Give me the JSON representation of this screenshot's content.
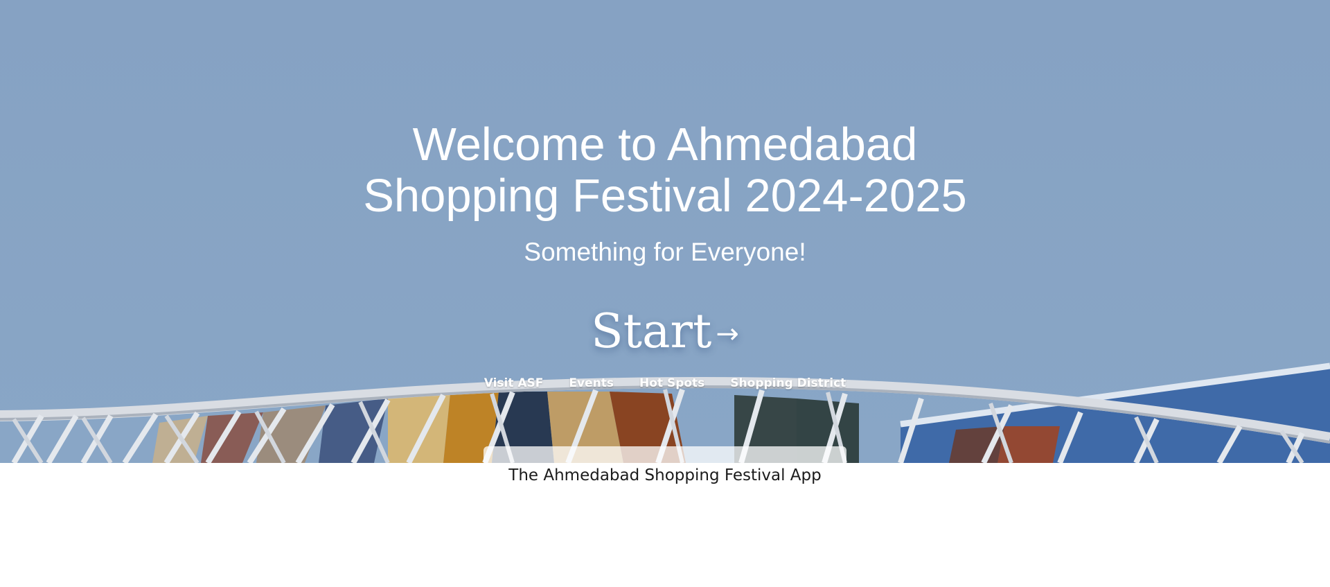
{
  "hero": {
    "title_line1": "Welcome to Ahmedabad",
    "title_line2": "Shopping Festival 2024-2025",
    "subtitle": "Something for Everyone!",
    "start_label": "Start",
    "start_arrow": "→",
    "nav": [
      {
        "label": "Visit ASF"
      },
      {
        "label": "Events"
      },
      {
        "label": "Hot Spots"
      },
      {
        "label": "Shopping District"
      }
    ],
    "background": "blue-sky-with-colorful-canopy-structure",
    "colors": {
      "sky": "#86a3c4",
      "text": "#ffffff"
    }
  },
  "app_section": {
    "caption": "The Ahmedabad Shopping Festival App"
  }
}
